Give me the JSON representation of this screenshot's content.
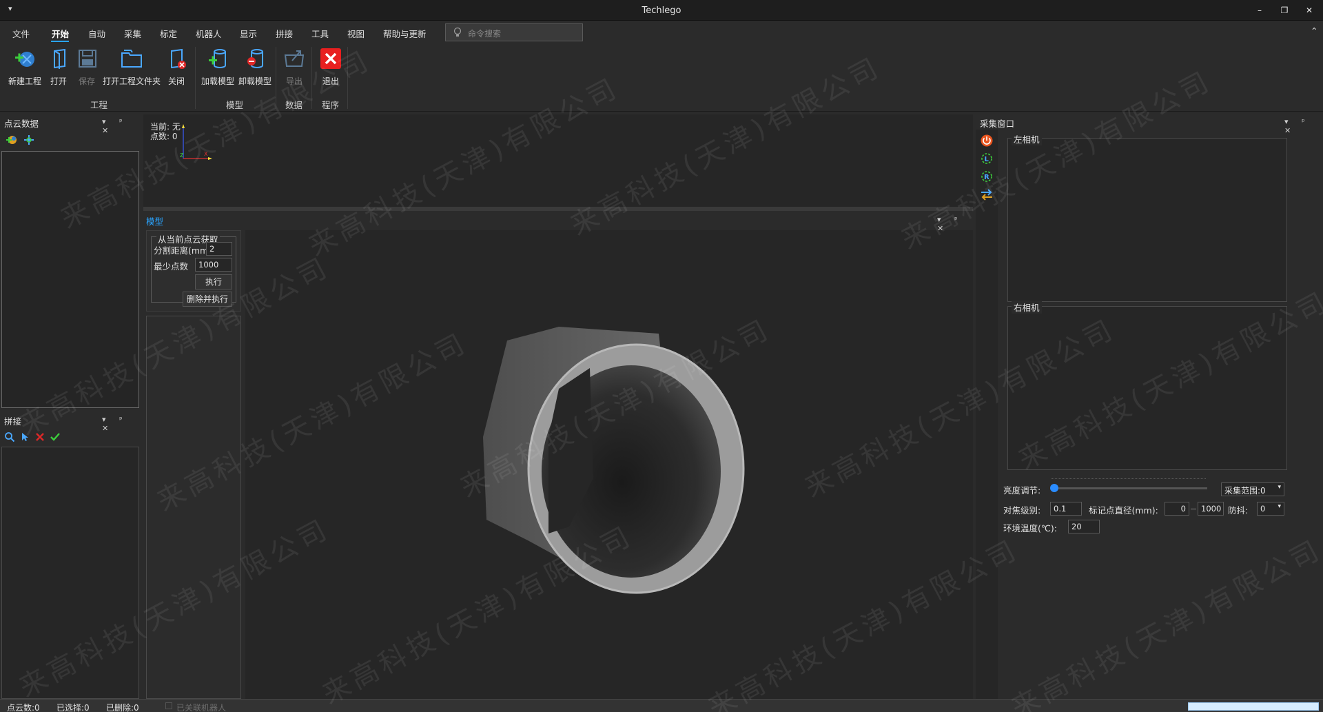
{
  "window": {
    "title": "Techlego",
    "quick_access": "▾",
    "min": "–",
    "restore": "❐",
    "close": "✕"
  },
  "menu": {
    "items": [
      "文件",
      "开始",
      "自动",
      "采集",
      "标定",
      "机器人",
      "显示",
      "拼接",
      "工具",
      "视图",
      "帮助与更新"
    ],
    "active": "开始",
    "search_placeholder": "命令搜索",
    "collapse": "⌃"
  },
  "ribbon": {
    "buttons": {
      "new_project": "新建工程",
      "open": "打开",
      "save": "保存",
      "open_folder": "打开工程文件夹",
      "close": "关闭",
      "load_model": "加载模型",
      "unload_model": "卸载模型",
      "export": "导出",
      "exit": "退出"
    },
    "groups": {
      "project": "工程",
      "model": "模型",
      "data": "数据",
      "program": "程序"
    }
  },
  "pointcloud_panel": {
    "title": "点云数据",
    "ctrls": "▾ ᵖ ✕"
  },
  "stitch_panel": {
    "title": "拼接",
    "ctrls": "▾ ᵖ ✕"
  },
  "viewer_top": {
    "current": "当前: 无",
    "points": "点数: 0",
    "axis_z": "Z",
    "axis_x": "X"
  },
  "model_panel": {
    "title": "模型",
    "ctrls": "▾ ᵖ ✕",
    "group_title": "从当前点云获取",
    "split_label": "分割距离(mm)",
    "split_value": "2",
    "min_points_label": "最少点数",
    "min_points_value": "1000",
    "exec": "执行",
    "delete_exec": "删除并执行"
  },
  "capture_panel": {
    "title": "采集窗口",
    "ctrls": "▾ ᵖ ✕",
    "left_camera": "左相机",
    "right_camera": "右相机",
    "brightness_label": "亮度调节:",
    "brightness_level": 0,
    "range_label": "采集范围:0",
    "focus_label": "对焦级别:",
    "focus_value": "0.1",
    "marker_label": "标记点直径(mm):",
    "marker_min": "0",
    "marker_max": "1000",
    "antishake_label": "防抖:",
    "antishake_value": "0",
    "temp_label": "环境温度(℃):",
    "temp_value": "20"
  },
  "status": {
    "cloud_count": "点云数:0",
    "selected": "已选择:0",
    "deleted": "已删除:0",
    "robot": "已关联机器人"
  },
  "watermark": "来高科技(天津)有限公司"
}
